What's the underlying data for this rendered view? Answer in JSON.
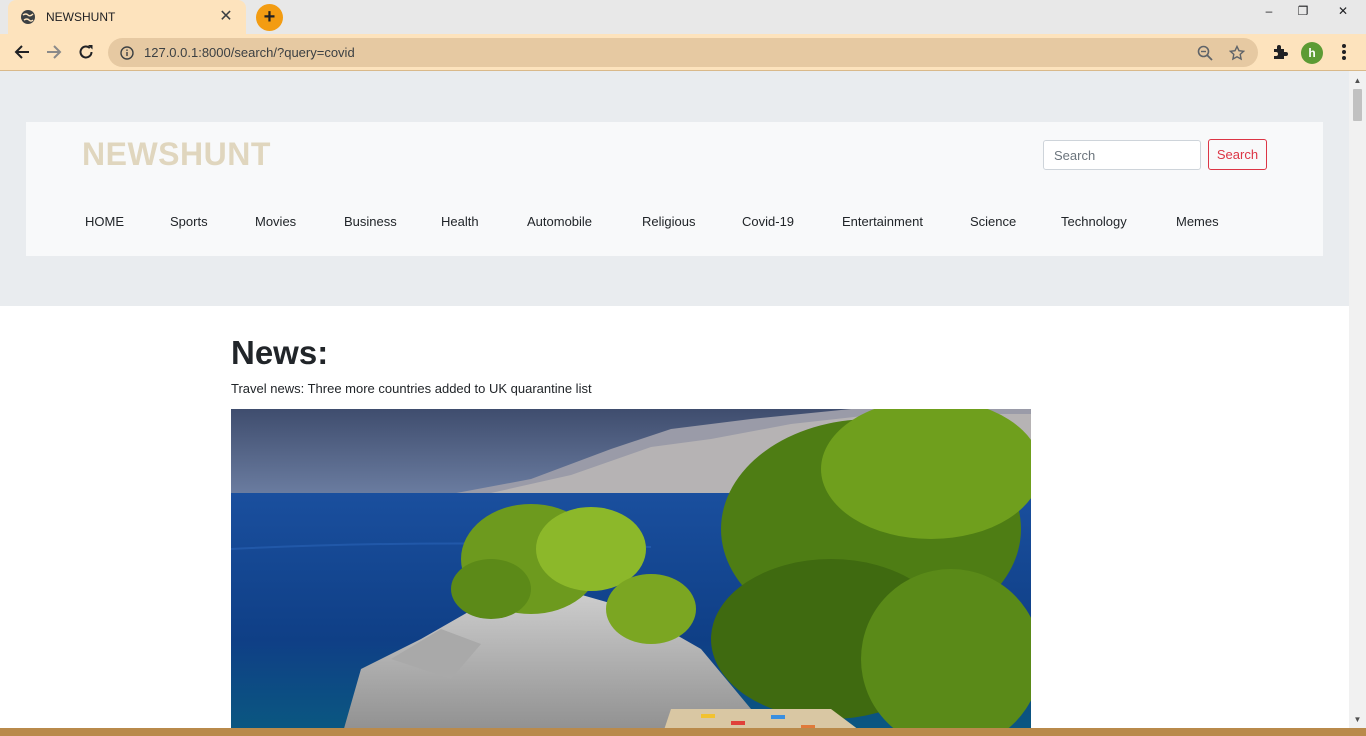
{
  "browser": {
    "tab_title": "NEWSHUNT",
    "tab_close": "✕",
    "new_tab": "+",
    "url": "127.0.0.1:8000/search/?query=covid",
    "profile_initial": "h",
    "window_controls": {
      "minimize": "–",
      "restore": "❐",
      "close": "✕"
    }
  },
  "site": {
    "brand": "NEWSHUNT",
    "search": {
      "placeholder": "Search",
      "button": "Search"
    },
    "menu": [
      "HOME",
      "Sports",
      "Movies",
      "Business",
      "Health",
      "Automobile",
      "Religious",
      "Covid-19",
      "Entertainment",
      "Science",
      "Technology",
      "Memes"
    ]
  },
  "content": {
    "heading": "News:",
    "headline": "Travel news: Three more countries added to UK quarantine list"
  },
  "colors": {
    "brand": "#e0d6be",
    "search_button": "#dc3545",
    "tab_bg": "#fde3bd",
    "new_tab": "#f39c12",
    "avatar": "#5c9b34"
  }
}
